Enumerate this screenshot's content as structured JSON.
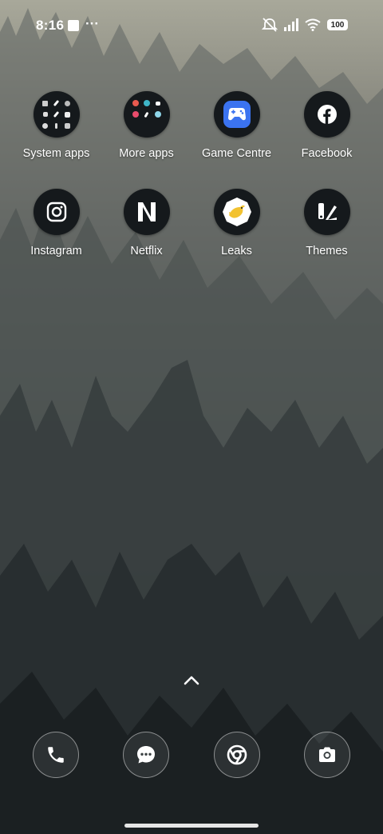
{
  "status_bar": {
    "time": "8:16",
    "overflow": "···",
    "battery": "100",
    "icons": [
      "notification-square-icon",
      "mute-vibrate-icon",
      "signal-icon",
      "wifi-icon",
      "battery-icon"
    ]
  },
  "apps": [
    {
      "label": "System apps",
      "icon": "folder-icon"
    },
    {
      "label": "More apps",
      "icon": "folder-icon"
    },
    {
      "label": "Game Centre",
      "icon": "gamepad-icon"
    },
    {
      "label": "Facebook",
      "icon": "facebook-icon"
    },
    {
      "label": "Instagram",
      "icon": "instagram-icon"
    },
    {
      "label": "Netflix",
      "icon": "netflix-icon"
    },
    {
      "label": "Leaks",
      "icon": "bird-icon"
    },
    {
      "label": "Themes",
      "icon": "themes-icon"
    }
  ],
  "dock": [
    "phone-icon",
    "messages-icon",
    "chrome-icon",
    "camera-icon"
  ],
  "colors": {
    "icon_background": "#15191c",
    "game_centre_blue": "#3b73f0",
    "leaks_yellow": "#f2c230"
  }
}
